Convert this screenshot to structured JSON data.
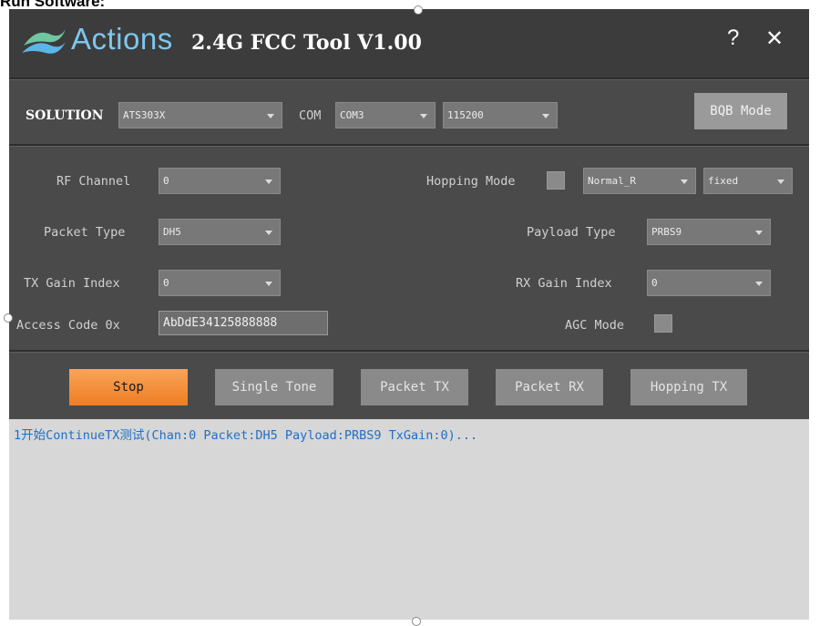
{
  "doc_heading": "Run Software:",
  "titlebar": {
    "logo_text": "Actions",
    "title": "2.4G FCC Tool V1.00",
    "help_label": "?",
    "close_label": "✕"
  },
  "config": {
    "solution_label": "SOLUTION",
    "solution_value": "ATS303X",
    "com_label": "COM",
    "com_value": "COM3",
    "baud_value": "115200",
    "bqb_button": "BQB Mode"
  },
  "params": {
    "rf_channel_label": "RF Channel",
    "rf_channel_value": "0",
    "hopping_mode_label": "Hopping Mode",
    "hopping_mode_value": "Normal_R",
    "hopping_type_value": "fixed",
    "packet_type_label": "Packet Type",
    "packet_type_value": "DH5",
    "payload_type_label": "Payload Type",
    "payload_type_value": "PRBS9",
    "tx_gain_label": "TX Gain Index",
    "tx_gain_value": "0",
    "rx_gain_label": "RX Gain Index",
    "rx_gain_value": "0",
    "access_code_label": "Access Code 0x",
    "access_code_value": "AbDdE34125888888",
    "agc_mode_label": "AGC Mode"
  },
  "actions": {
    "stop": "Stop",
    "single_tone": "Single Tone",
    "packet_tx": "Packet TX",
    "packet_rx": "Packet RX",
    "hopping_tx": "Hopping TX"
  },
  "log": {
    "lines": [
      "1开始ContinueTX测试(Chan:0 Packet:DH5 Payload:PRBS9 TxGain:0)..."
    ]
  },
  "colors": {
    "accent_orange": "#ef7d22",
    "logo_blue": "#7dc7ee",
    "log_text": "#1f6fc8"
  }
}
